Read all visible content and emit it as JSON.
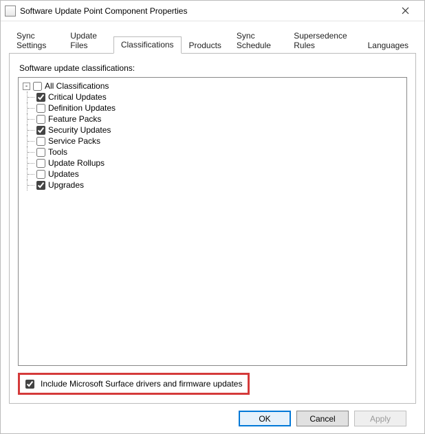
{
  "window": {
    "title": "Software Update Point Component Properties"
  },
  "tabs": [
    {
      "label": "Sync Settings",
      "active": false
    },
    {
      "label": "Update Files",
      "active": false
    },
    {
      "label": "Classifications",
      "active": true
    },
    {
      "label": "Products",
      "active": false
    },
    {
      "label": "Sync Schedule",
      "active": false
    },
    {
      "label": "Supersedence Rules",
      "active": false
    },
    {
      "label": "Languages",
      "active": false
    }
  ],
  "section_label": "Software update classifications:",
  "tree": {
    "root": {
      "label": "All Classifications",
      "checked": false
    },
    "children": [
      {
        "label": "Critical Updates",
        "checked": true
      },
      {
        "label": "Definition Updates",
        "checked": false
      },
      {
        "label": "Feature Packs",
        "checked": false
      },
      {
        "label": "Security Updates",
        "checked": true
      },
      {
        "label": "Service Packs",
        "checked": false
      },
      {
        "label": "Tools",
        "checked": false
      },
      {
        "label": "Update Rollups",
        "checked": false
      },
      {
        "label": "Updates",
        "checked": false
      },
      {
        "label": "Upgrades",
        "checked": true
      }
    ]
  },
  "include_surface": {
    "label": "Include Microsoft Surface drivers and firmware updates",
    "checked": true
  },
  "buttons": {
    "ok": "OK",
    "cancel": "Cancel",
    "apply": "Apply"
  }
}
